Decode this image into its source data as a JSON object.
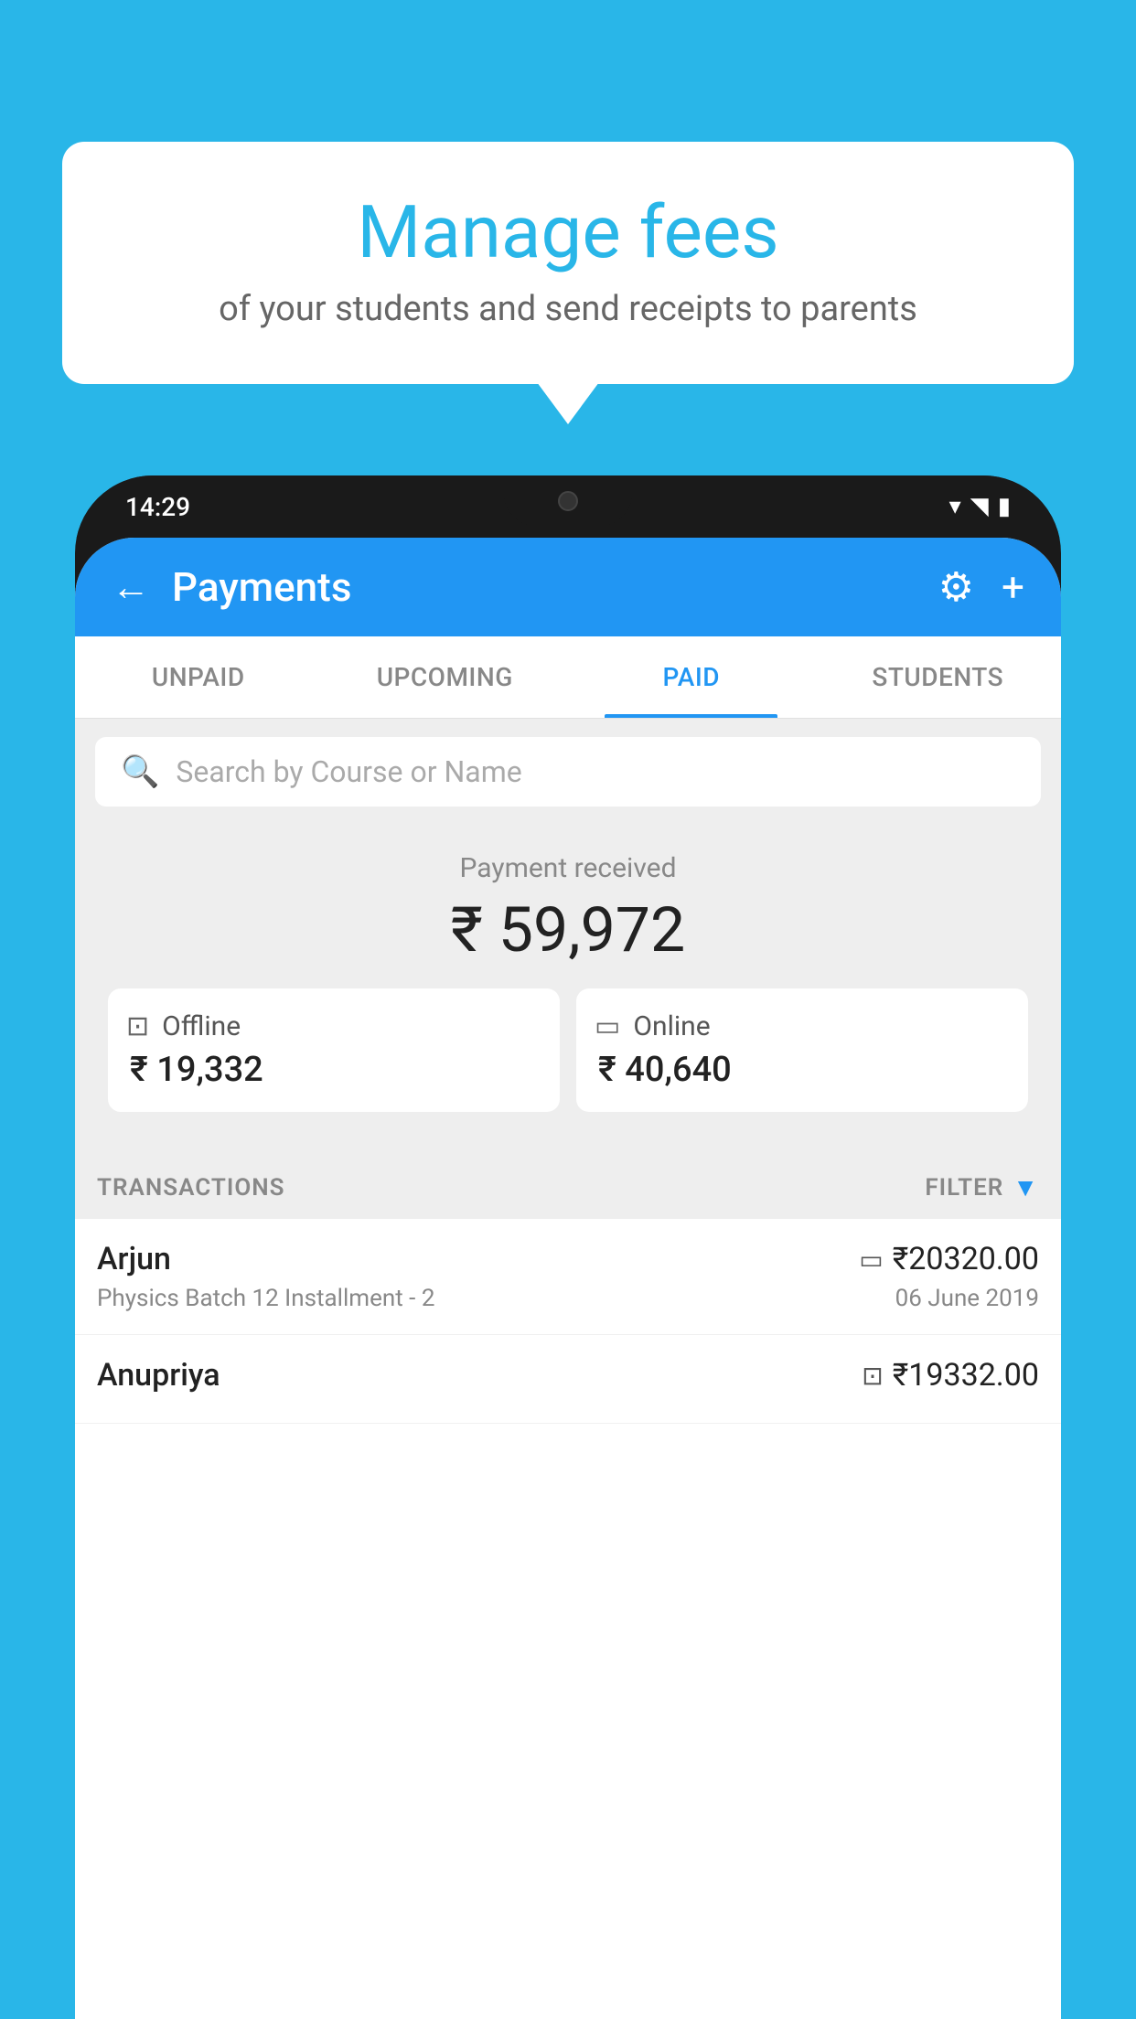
{
  "background_color": "#29b6e8",
  "bubble": {
    "title": "Manage fees",
    "subtitle": "of your students and send receipts to parents"
  },
  "phone": {
    "status_bar": {
      "time": "14:29"
    },
    "header": {
      "title": "Payments",
      "back_label": "←",
      "settings_icon": "⚙",
      "add_icon": "+"
    },
    "tabs": [
      {
        "label": "UNPAID",
        "active": false
      },
      {
        "label": "UPCOMING",
        "active": false
      },
      {
        "label": "PAID",
        "active": true
      },
      {
        "label": "STUDENTS",
        "active": false
      }
    ],
    "search": {
      "placeholder": "Search by Course or Name"
    },
    "payment_summary": {
      "label": "Payment received",
      "amount": "₹ 59,972",
      "offline_label": "Offline",
      "offline_amount": "₹ 19,332",
      "online_label": "Online",
      "online_amount": "₹ 40,640"
    },
    "transactions": {
      "header_label": "TRANSACTIONS",
      "filter_label": "FILTER",
      "items": [
        {
          "name": "Arjun",
          "mode_icon": "card",
          "amount": "₹20320.00",
          "description": "Physics Batch 12 Installment - 2",
          "date": "06 June 2019"
        },
        {
          "name": "Anupriya",
          "mode_icon": "cash",
          "amount": "₹19332.00",
          "description": "",
          "date": ""
        }
      ]
    }
  }
}
